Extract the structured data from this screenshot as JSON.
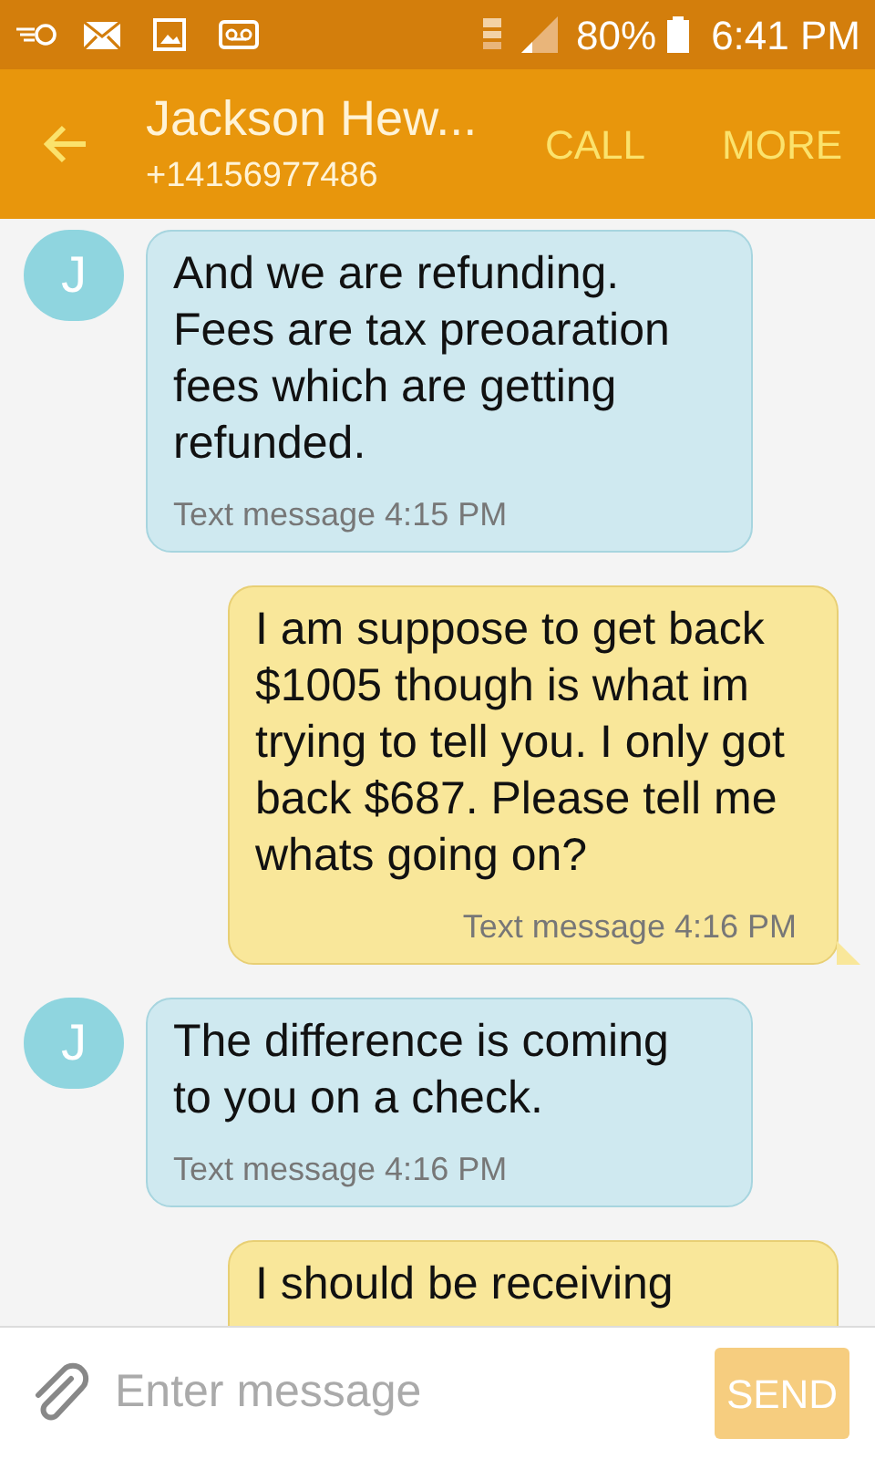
{
  "status_bar": {
    "battery": "80%",
    "time": "6:41 PM"
  },
  "header": {
    "title": "Jackson Hew...",
    "subtitle": "+14156977486",
    "actions": [
      "CALL",
      "MORE"
    ]
  },
  "messages": [
    {
      "kind": "incoming",
      "avatar": "J",
      "text": "And we are refunding. Fees are tax preoaration fees which are getting refunded.",
      "meta": "Text message 4:15 PM"
    },
    {
      "kind": "outgoing",
      "text": "I am suppose to get back $1005 though is what im trying to tell you. I only got back $687. Please tell me whats going on?",
      "meta": "Text message 4:16 PM"
    },
    {
      "kind": "incoming",
      "avatar": "J",
      "text": "The difference is coming to you on a check.",
      "meta": "Text message 4:16 PM"
    },
    {
      "kind": "outgoing",
      "text": "I should be receiving"
    }
  ],
  "composer": {
    "placeholder": "Enter message",
    "send": "SEND"
  }
}
